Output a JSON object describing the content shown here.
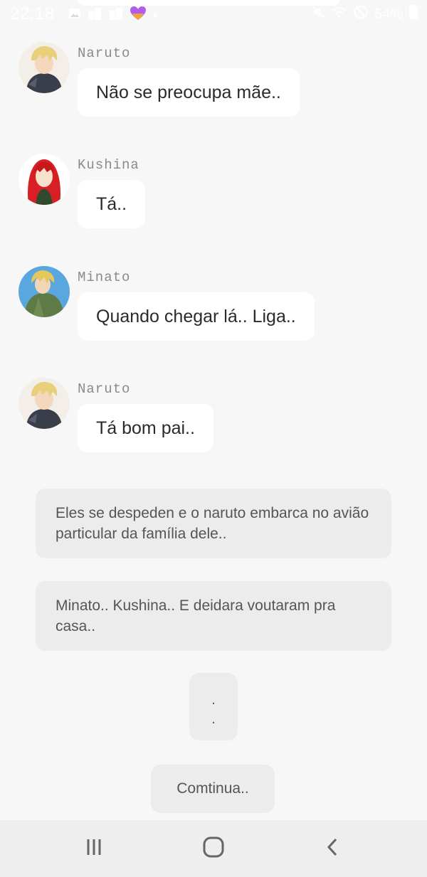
{
  "status_bar": {
    "time": "22:18",
    "battery": "54%",
    "left_icons": [
      "image-icon",
      "app-icon",
      "app-icon",
      "amino-heart-icon",
      "dot-icon"
    ],
    "right_icons": [
      "mute-icon",
      "wifi-icon",
      "blocked-icon",
      "battery-icon"
    ]
  },
  "messages": [
    {
      "sender": "Naruto",
      "text": "Não se preocupa mãe..",
      "avatar": "naruto-avatar"
    },
    {
      "sender": "Kushina",
      "text": "Tá..",
      "avatar": "kushina-avatar"
    },
    {
      "sender": "Minato",
      "text": "Quando chegar lá.. Liga..",
      "avatar": "minato-avatar"
    },
    {
      "sender": "Naruto",
      "text": "Tá bom pai..",
      "avatar": "naruto-avatar"
    }
  ],
  "narrations": [
    {
      "text": "Eles se despeden e o naruto embarca no avião particular da família dele.."
    },
    {
      "text": "Minato.. Kushina.. E deidara voutaram pra casa.."
    }
  ],
  "dots": {
    "line1": ".",
    "line2": "."
  },
  "continue_text": "Comtinua..",
  "nav": {
    "icons": [
      "recent-apps-icon",
      "home-icon",
      "back-icon"
    ]
  },
  "colors": {
    "background": "#f7f7f7",
    "bubble": "#ffffff",
    "narration": "#ececec",
    "nav_bar": "#eeeeee",
    "sender_name": "#8a8a8a"
  }
}
